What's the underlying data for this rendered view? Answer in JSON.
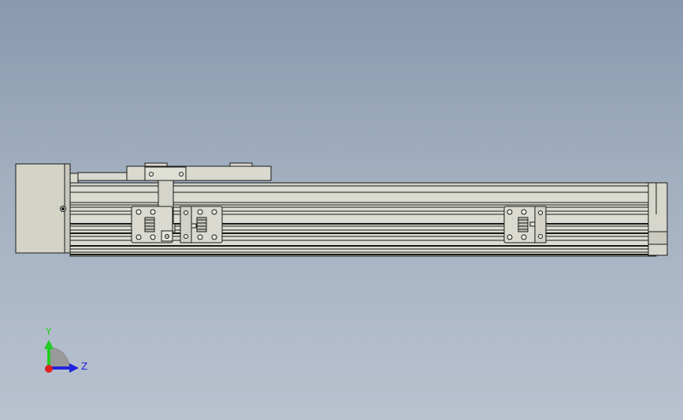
{
  "viewport": {
    "background_top": "#8899ae",
    "background_bottom": "#b9c2cf"
  },
  "model": {
    "part_fill": "#d9d9cf",
    "part_edge": "#1a1a1a",
    "motor_fill": "#d3d3c8",
    "shadow_fill": "#b8b8ad"
  },
  "triad": {
    "y_label": "Y",
    "z_label": "Z",
    "y_color": "#22cc22",
    "z_color": "#2222dd",
    "x_color": "#dd2222"
  }
}
